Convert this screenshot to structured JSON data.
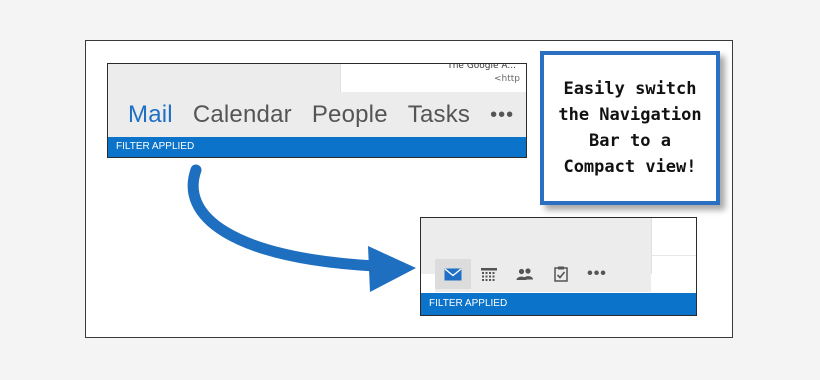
{
  "full_view": {
    "email_preview_line1": "The Google A...",
    "email_preview_line2": "<http",
    "nav_items": [
      {
        "label": "Mail",
        "active": true
      },
      {
        "label": "Calendar",
        "active": false
      },
      {
        "label": "People",
        "active": false
      },
      {
        "label": "Tasks",
        "active": false
      }
    ],
    "more_label": "•••",
    "status_text": "FILTER APPLIED"
  },
  "compact_view": {
    "icons": [
      "mail-icon",
      "calendar-icon",
      "people-icon",
      "tasks-icon"
    ],
    "more_label": "•••",
    "status_text": "FILTER APPLIED"
  },
  "callout": {
    "text": "Easily switch\nthe Navigation\nBar to a\nCompact view!"
  },
  "colors": {
    "accent": "#1f6fc4",
    "status_bar": "#0b73c9",
    "arrow": "#1e6fc0",
    "callout_border": "#2a6fc0"
  }
}
